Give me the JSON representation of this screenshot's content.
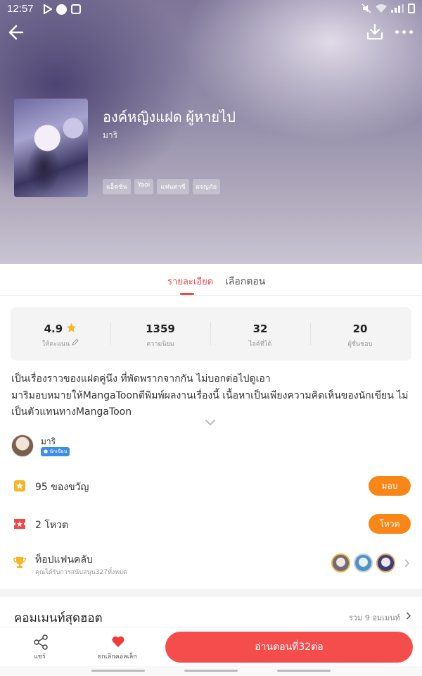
{
  "status_bar": {
    "time": "12:57"
  },
  "book": {
    "title": "องค์หญิงแฝด ผู้หายไป",
    "author": "มาริ",
    "tags": [
      "แอ็คชั่น",
      "Yaoi",
      "แฟนตาซี",
      "ผจญภัย"
    ]
  },
  "tabs": {
    "details": "รายละเอียด",
    "chapters": "เลือกตอน"
  },
  "stats": [
    {
      "value": "4.9",
      "label": "ให้คะแนน"
    },
    {
      "value": "1359",
      "label": "ความนิยม"
    },
    {
      "value": "32",
      "label": "ไลค์ที่ได้"
    },
    {
      "value": "20",
      "label": "ผู้ชื่นชอบ"
    }
  ],
  "description": {
    "line1": "เป็นเรื่องราวของแฝดคู่นึง ที่พัดพรากจากกัน ไม่บอกต่อไปดูเอา",
    "line2": "มาริมอบหมายให้MangaToonตีพิมพ์ผลงานเรื่องนี้ เนื้อหาเป็นเพียงความคิดเห็นของนักเขียน ไม่เป็นตัวแทนทางMangaToon"
  },
  "author_card": {
    "name": "มาริ",
    "badge": "นักเขียน"
  },
  "gifts": {
    "label": "95 ของขวัญ",
    "button": "มอบ"
  },
  "votes": {
    "label": "2 โหวต",
    "button": "โหวต"
  },
  "fanclub": {
    "title": "ท็อปแฟนคลับ",
    "subtitle": "คุณได้รับการสนับสนุน327ทั้งหมด"
  },
  "comments": {
    "title": "คอมเมนท์สุดฮอต",
    "total": "รวม 9 อมเมนท์"
  },
  "bottom": {
    "share": "แชร์",
    "favorite": "ยกเลิกคอลเล็ก",
    "read": "อ่านตอนที่32ต่อ"
  },
  "colors": {
    "accent": "#e94b4b",
    "orange": "#f88718",
    "read_button": "#f54c4c"
  },
  "icons": [
    "back-arrow-icon",
    "download-icon",
    "more-icon",
    "edit-icon",
    "star-icon",
    "chevron-down-icon",
    "gift-icon",
    "vote-icon",
    "trophy-icon",
    "share-icon",
    "heart-icon",
    "chevron-right-icon"
  ]
}
